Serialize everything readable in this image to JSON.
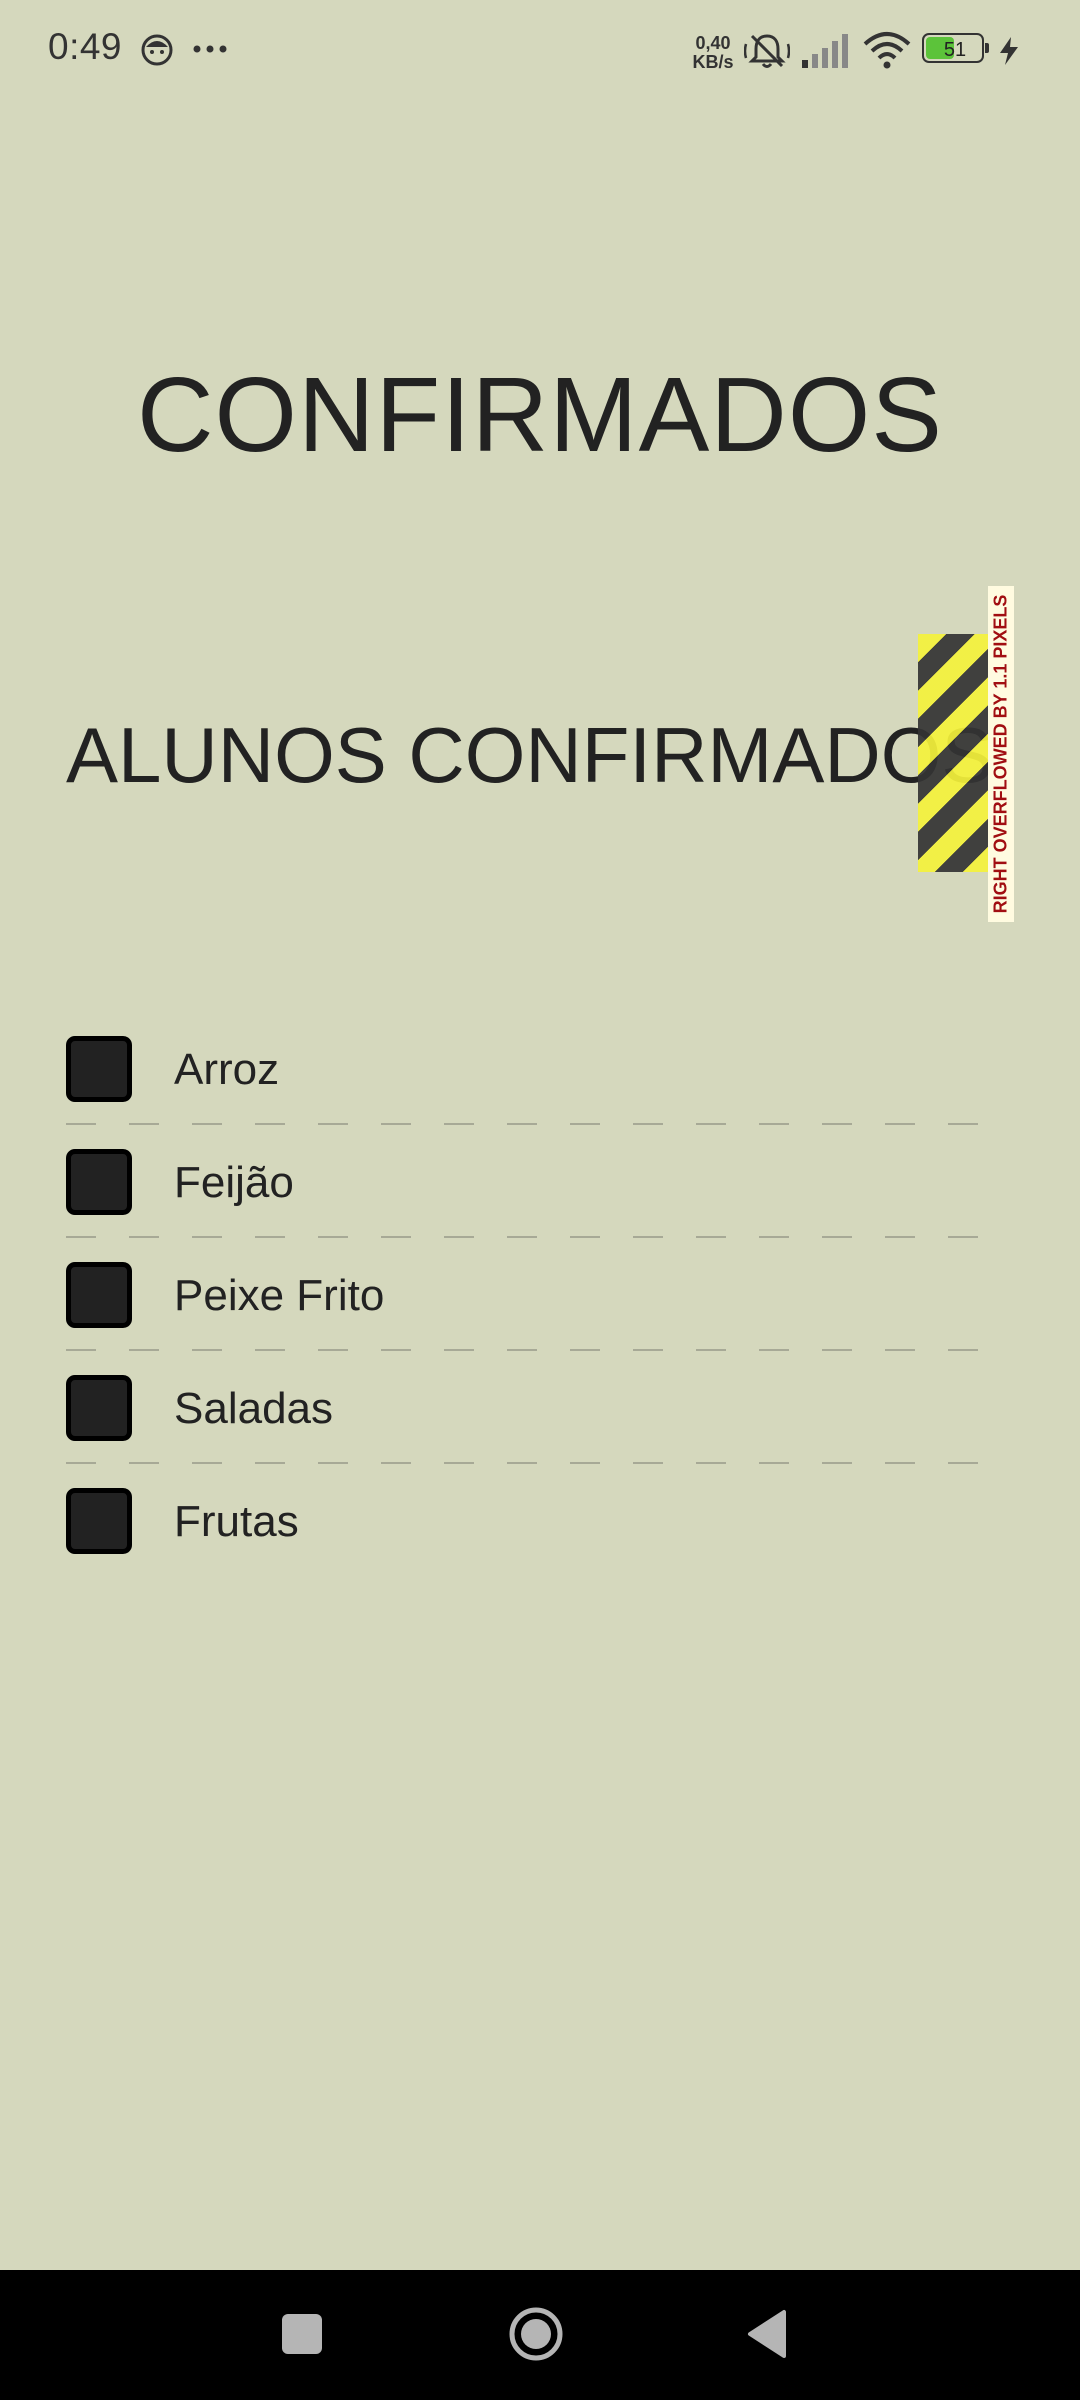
{
  "status_bar": {
    "time": "0:49",
    "network_speed_value": "0,40",
    "network_speed_unit": "KB/s",
    "battery_level": "51",
    "battery_fraction": 0.51,
    "icons": [
      "face-icon",
      "more-dots-icon",
      "silent-bell-icon",
      "cellular-signal-icon",
      "wifi-icon",
      "battery-icon",
      "charging-bolt-icon"
    ]
  },
  "page": {
    "title": "CONFIRMADOS",
    "subtitle": "ALUNOS CONFIRMADOS CONFIRMADOS",
    "overflow_warning": "RIGHT OVERFLOWED BY 1.1 PIXELS"
  },
  "food_list": {
    "items": [
      {
        "label": "Arroz",
        "checked": false
      },
      {
        "label": "Feijão",
        "checked": false
      },
      {
        "label": "Peixe Frito",
        "checked": false
      },
      {
        "label": "Saladas",
        "checked": false
      },
      {
        "label": "Frutas",
        "checked": false
      }
    ]
  },
  "nav_bar": {
    "icons": [
      "recents-icon",
      "home-icon",
      "back-icon"
    ]
  },
  "colors": {
    "background": "#d5d8bd",
    "text": "#222222",
    "checkbox_fill": "#222222",
    "divider": "#a7a996",
    "warning_yellow": "#f5f23b",
    "warning_text": "#a10e12",
    "battery_fill": "#5cc33a",
    "nav_background": "#000000"
  }
}
